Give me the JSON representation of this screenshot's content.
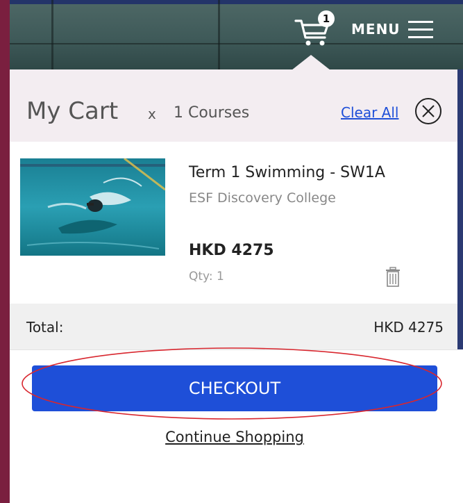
{
  "header": {
    "cart_badge": "1",
    "menu_label": "MENU"
  },
  "cart": {
    "title": "My Cart",
    "multiplier": "x",
    "count_label": "1 Courses",
    "clear_all": "Clear All"
  },
  "item": {
    "name": "Term 1 Swimming - SW1A",
    "school": "ESF Discovery College",
    "price": "HKD 4275",
    "qty": "Qty: 1"
  },
  "total": {
    "label": "Total:",
    "value": "HKD 4275"
  },
  "actions": {
    "checkout": "CHECKOUT",
    "continue_shopping": "Continue Shopping"
  },
  "colors": {
    "primary": "#1e4fd8",
    "header_bg": "#2b3a73",
    "cart_header_bg": "#f3edf1",
    "annotation": "#d8262e"
  },
  "icons": {
    "cart": "shopping-cart-icon",
    "menu": "hamburger-menu-icon",
    "close": "close-circle-icon",
    "delete": "trash-icon"
  }
}
